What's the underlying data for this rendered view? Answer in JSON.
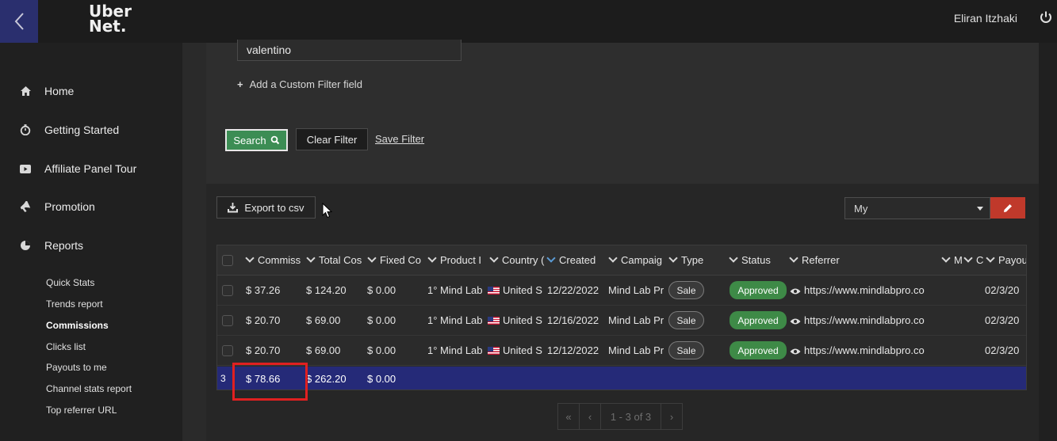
{
  "app": {
    "logo_line1": "Uber",
    "logo_line2": "Net.",
    "user_name": "Eliran Itzhaki"
  },
  "sidebar": {
    "items": [
      {
        "label": "Home",
        "icon": "home-icon"
      },
      {
        "label": "Getting Started",
        "icon": "stopwatch-icon"
      },
      {
        "label": "Affiliate Panel Tour",
        "icon": "video-icon"
      },
      {
        "label": "Promotion",
        "icon": "megaphone-icon"
      },
      {
        "label": "Reports",
        "icon": "pie-chart-icon"
      }
    ],
    "report_links": [
      "Quick Stats",
      "Trends report",
      "Commissions",
      "Clicks list",
      "Payouts to me",
      "Channel stats report",
      "Top referrer URL"
    ],
    "active_report": "Commissions"
  },
  "filter": {
    "input_value": "valentino",
    "add_custom_filter": "Add a Custom Filter field",
    "search_label": "Search",
    "clear_label": "Clear Filter",
    "save_label": "Save Filter"
  },
  "toolbar": {
    "export_label": "Export to csv",
    "view_selected": "My"
  },
  "table": {
    "columns": [
      "Commiss",
      "Total Cos",
      "Fixed Co",
      "Product I",
      "Country (",
      "Created",
      "Campaig",
      "Type",
      "Status",
      "Referrer",
      "M",
      "C",
      "Payou"
    ],
    "rows": [
      {
        "commission": "$ 37.26",
        "total_cost": "$ 124.20",
        "fixed_cost": "$ 0.00",
        "product": "1° Mind Lab",
        "country": "United S",
        "created": "12/22/2022",
        "campaign": "Mind Lab Pr",
        "type": "Sale",
        "status": "Approved",
        "referrer": "https://www.mindlabpro.co",
        "payout": "02/3/20"
      },
      {
        "commission": "$ 20.70",
        "total_cost": "$ 69.00",
        "fixed_cost": "$ 0.00",
        "product": "1° Mind Lab",
        "country": "United S",
        "created": "12/16/2022",
        "campaign": "Mind Lab Pr",
        "type": "Sale",
        "status": "Approved",
        "referrer": "https://www.mindlabpro.co",
        "payout": "02/3/20"
      },
      {
        "commission": "$ 20.70",
        "total_cost": "$ 69.00",
        "fixed_cost": "$ 0.00",
        "product": "1° Mind Lab",
        "country": "United S",
        "created": "12/12/2022",
        "campaign": "Mind Lab Pr",
        "type": "Sale",
        "status": "Approved",
        "referrer": "https://www.mindlabpro.co",
        "payout": "02/3/20"
      }
    ],
    "totals": {
      "count": "3",
      "commission": "$ 78.66",
      "total_cost": "$ 262.20",
      "fixed_cost": "$ 0.00"
    }
  },
  "pagination": {
    "first": "«",
    "prev": "‹",
    "range": "1 - 3 of 3",
    "next": "›"
  },
  "colors": {
    "accent": "#252a78",
    "success": "#3c8d54",
    "danger": "#c0392b",
    "highlight": "#e02020"
  }
}
